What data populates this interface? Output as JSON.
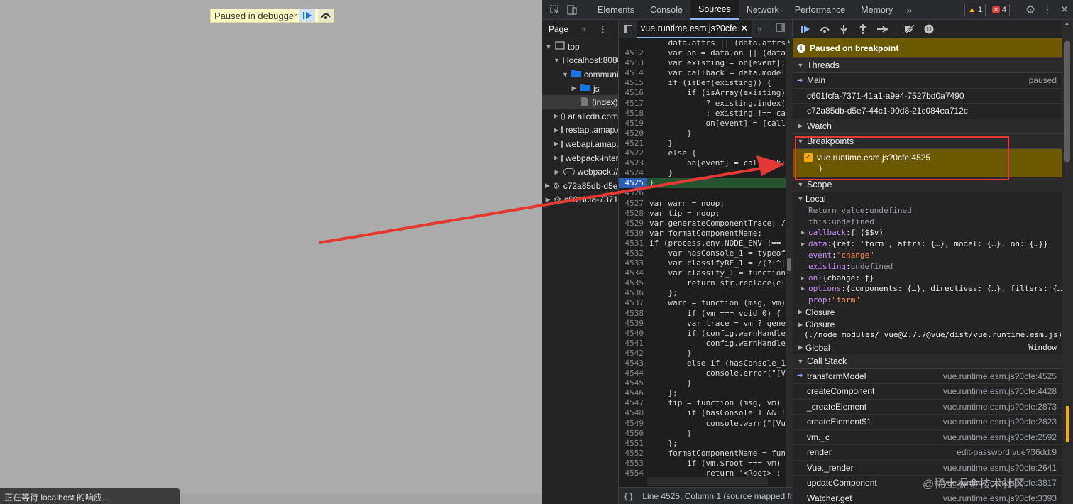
{
  "viewport": {
    "paused_label": "Paused in debugger",
    "status_text": "正在等待 localhost 的响应..."
  },
  "tabs": [
    "Elements",
    "Console",
    "Sources",
    "Network",
    "Performance",
    "Memory"
  ],
  "active_tab": "Sources",
  "badges": {
    "warnings": "1",
    "errors": "4"
  },
  "navigator": {
    "header": "Page",
    "items": [
      {
        "label": "top",
        "type": "frame",
        "indent": 0,
        "open": true
      },
      {
        "label": "localhost:8080",
        "type": "cloud",
        "indent": 1,
        "open": true
      },
      {
        "label": "community",
        "type": "folder",
        "indent": 2,
        "open": true
      },
      {
        "label": "js",
        "type": "folder",
        "indent": 3,
        "open": false
      },
      {
        "label": "(index)",
        "type": "file",
        "indent": 3,
        "open": null
      },
      {
        "label": "at.alicdn.com",
        "type": "cloud",
        "indent": 1,
        "open": false
      },
      {
        "label": "restapi.amap.com",
        "type": "cloud",
        "indent": 1,
        "open": false
      },
      {
        "label": "webapi.amap.com",
        "type": "cloud",
        "indent": 1,
        "open": false
      },
      {
        "label": "webpack-internal://",
        "type": "cloud",
        "indent": 1,
        "open": false
      },
      {
        "label": "webpack://",
        "type": "cloud",
        "indent": 1,
        "open": false
      },
      {
        "label": "c72a85db-d5e7",
        "type": "gear",
        "indent": 0,
        "open": false
      },
      {
        "label": "c601fcfa-7371",
        "type": "gear",
        "indent": 0,
        "open": false
      }
    ]
  },
  "editor": {
    "tab_label": "vue.runtime.esm.js?0cfe",
    "breakpoint_line": 4525,
    "footer": "Line 4525, Column 1  (source mapped from",
    "lines": [
      {
        "n": "",
        "t": "    data.attrs || (data.attrs"
      },
      {
        "n": "4512",
        "t": "    var on = data.on || (data"
      },
      {
        "n": "4513",
        "t": "    var existing = on[event];"
      },
      {
        "n": "4514",
        "t": "    var callback = data.model"
      },
      {
        "n": "4515",
        "t": "    if (isDef(existing)) {"
      },
      {
        "n": "4516",
        "t": "        if (isArray(existing)"
      },
      {
        "n": "4517",
        "t": "            ? existing.index("
      },
      {
        "n": "4518",
        "t": "            : existing !== ca"
      },
      {
        "n": "4519",
        "t": "            on[event] = [call"
      },
      {
        "n": "4520",
        "t": "        }"
      },
      {
        "n": "4521",
        "t": "    }"
      },
      {
        "n": "4522",
        "t": "    else {"
      },
      {
        "n": "4523",
        "t": "        on[event] = callback;"
      },
      {
        "n": "4524",
        "t": "    }"
      },
      {
        "n": "4525",
        "t": "}"
      },
      {
        "n": "4526",
        "t": ""
      },
      {
        "n": "4527",
        "t": "var warn = noop;"
      },
      {
        "n": "4528",
        "t": "var tip = noop;"
      },
      {
        "n": "4529",
        "t": "var generateComponentTrace; /"
      },
      {
        "n": "4530",
        "t": "var formatComponentName;"
      },
      {
        "n": "4531",
        "t": "if (process.env.NODE_ENV !=="
      },
      {
        "n": "4532",
        "t": "    var hasConsole_1 = typeof"
      },
      {
        "n": "4533",
        "t": "    var classifyRE_1 = /(?:^|"
      },
      {
        "n": "4534",
        "t": "    var classify_1 = function"
      },
      {
        "n": "4535",
        "t": "        return str.replace(cl"
      },
      {
        "n": "4536",
        "t": "    };"
      },
      {
        "n": "4537",
        "t": "    warn = function (msg, vm)"
      },
      {
        "n": "4538",
        "t": "        if (vm === void 0) {"
      },
      {
        "n": "4539",
        "t": "        var trace = vm ? gene"
      },
      {
        "n": "4540",
        "t": "        if (config.warnHandle"
      },
      {
        "n": "4541",
        "t": "            config.warnHandle"
      },
      {
        "n": "4542",
        "t": "        }"
      },
      {
        "n": "4543",
        "t": "        else if (hasConsole_1"
      },
      {
        "n": "4544",
        "t": "            console.error(\"[V"
      },
      {
        "n": "4545",
        "t": "        }"
      },
      {
        "n": "4546",
        "t": "    };"
      },
      {
        "n": "4547",
        "t": "    tip = function (msg, vm)"
      },
      {
        "n": "4548",
        "t": "        if (hasConsole_1 && !"
      },
      {
        "n": "4549",
        "t": "            console.warn(\"[Vu"
      },
      {
        "n": "4550",
        "t": "        }"
      },
      {
        "n": "4551",
        "t": "    };"
      },
      {
        "n": "4552",
        "t": "    formatComponentName = fun"
      },
      {
        "n": "4553",
        "t": "        if (vm.$root === vm)"
      },
      {
        "n": "4554",
        "t": "            return '<Root>';"
      }
    ]
  },
  "debugger": {
    "paused_banner": "Paused on breakpoint",
    "sections": {
      "threads": "Threads",
      "watch": "Watch",
      "breakpoints": "Breakpoints",
      "scope": "Scope",
      "call_stack": "Call Stack"
    },
    "threads": [
      {
        "name": "Main",
        "status": "paused",
        "current": true
      },
      {
        "name": "c601fcfa-7371-41a1-a9e4-7527bd0a7490",
        "status": "",
        "current": false
      },
      {
        "name": "c72a85db-d5e7-44c1-90d8-21c084ea712c",
        "status": "",
        "current": false
      }
    ],
    "breakpoint": {
      "label": "vue.runtime.esm.js?0cfe:4525",
      "code": "}",
      "checked": true
    },
    "scope": {
      "local_label": "Local",
      "local": [
        {
          "key": "Return value",
          "value": "undefined",
          "expandable": false
        },
        {
          "key": "this",
          "value": "undefined",
          "expandable": false
        },
        {
          "key": "callback",
          "value": "ƒ ($$v)",
          "expandable": true
        },
        {
          "key": "data",
          "value": "{ref: 'form', attrs: {…}, model: {…}, on: {…}}",
          "expandable": true
        },
        {
          "key": "event",
          "value": "\"change\"",
          "expandable": false
        },
        {
          "key": "existing",
          "value": "undefined",
          "expandable": false
        },
        {
          "key": "on",
          "value": "{change: ƒ}",
          "expandable": true
        },
        {
          "key": "options",
          "value": "{components: {…}, directives: {…}, filters: {…",
          "expandable": true
        },
        {
          "key": "prop",
          "value": "\"form\"",
          "expandable": false
        }
      ],
      "closure1": "Closure",
      "closure2": "Closure",
      "closure2_path": "(./node_modules/_vue@2.7.7@vue/dist/vue.runtime.esm.js)",
      "global": "Global",
      "global_value": "Window"
    },
    "call_stack": [
      {
        "fn": "transformModel",
        "loc": "vue.runtime.esm.js?0cfe:4525",
        "current": true
      },
      {
        "fn": "createComponent",
        "loc": "vue.runtime.esm.js?0cfe:4428",
        "current": false
      },
      {
        "fn": "_createElement",
        "loc": "vue.runtime.esm.js?0cfe:2873",
        "current": false
      },
      {
        "fn": "createElement$1",
        "loc": "vue.runtime.esm.js?0cfe:2823",
        "current": false
      },
      {
        "fn": "vm._c",
        "loc": "vue.runtime.esm.js?0cfe:2592",
        "current": false
      },
      {
        "fn": "render",
        "loc": "edit-password.vue?36dd:9",
        "current": false
      },
      {
        "fn": "Vue._render",
        "loc": "vue.runtime.esm.js?0cfe:2641",
        "current": false
      },
      {
        "fn": "updateComponent",
        "loc": "vue.runtime.esm.js?0cfe:3817",
        "current": false
      },
      {
        "fn": "Watcher.get",
        "loc": "vue.runtime.esm.js?0cfe:3393",
        "current": false
      }
    ]
  },
  "watermark": "@稀土掘金技术社区",
  "colors": {
    "annotation": "#e53935",
    "accent": "#8ab4f8",
    "paused": "#6d5a00"
  }
}
